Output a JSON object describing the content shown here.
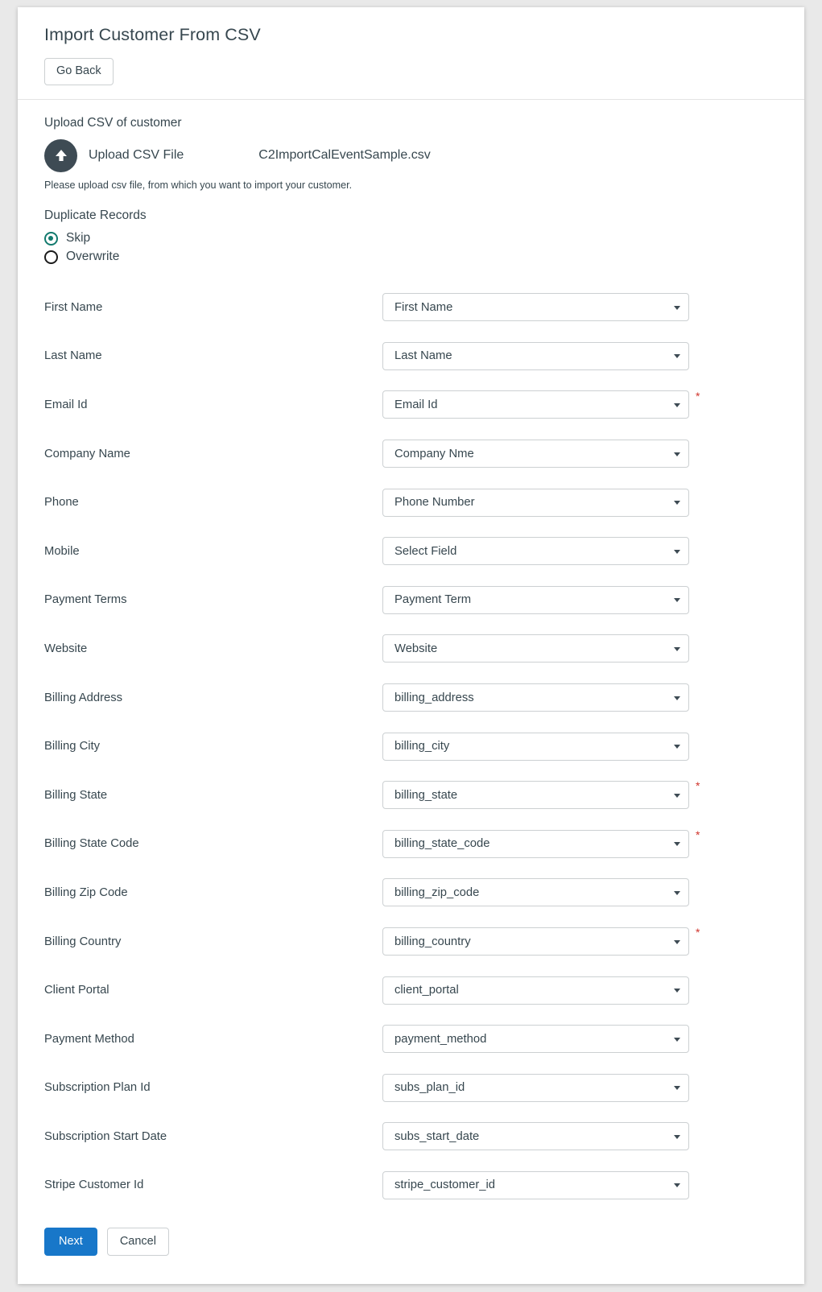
{
  "header": {
    "title": "Import Customer From CSV",
    "go_back_label": "Go Back"
  },
  "upload": {
    "section_title": "Upload CSV of customer",
    "button_label": "Upload CSV File",
    "file_name": "C2ImportCalEventSample.csv",
    "hint": "Please upload csv file, from which you want to import your customer.",
    "icon": "upload-arrow-icon"
  },
  "duplicates": {
    "section_title": "Duplicate Records",
    "options": [
      {
        "label": "Skip",
        "selected": true
      },
      {
        "label": "Overwrite",
        "selected": false
      }
    ]
  },
  "mapping": {
    "rows": [
      {
        "label": "First Name",
        "value": "First Name",
        "required": false
      },
      {
        "label": "Last Name",
        "value": "Last Name",
        "required": false
      },
      {
        "label": "Email Id",
        "value": "Email Id",
        "required": true
      },
      {
        "label": "Company Name",
        "value": "Company Nme",
        "required": false
      },
      {
        "label": "Phone",
        "value": "Phone Number",
        "required": false
      },
      {
        "label": "Mobile",
        "value": "Select Field",
        "required": false
      },
      {
        "label": "Payment Terms",
        "value": "Payment Term",
        "required": false
      },
      {
        "label": "Website",
        "value": "Website",
        "required": false
      },
      {
        "label": "Billing Address",
        "value": "billing_address",
        "required": false
      },
      {
        "label": "Billing City",
        "value": "billing_city",
        "required": false
      },
      {
        "label": "Billing State",
        "value": "billing_state",
        "required": true
      },
      {
        "label": "Billing State Code",
        "value": "billing_state_code",
        "required": true
      },
      {
        "label": "Billing Zip Code",
        "value": "billing_zip_code",
        "required": false
      },
      {
        "label": "Billing Country",
        "value": "billing_country",
        "required": true
      },
      {
        "label": "Client Portal",
        "value": "client_portal",
        "required": false
      },
      {
        "label": "Payment Method",
        "value": "payment_method",
        "required": false
      },
      {
        "label": "Subscription Plan Id",
        "value": "subs_plan_id",
        "required": false
      },
      {
        "label": "Subscription Start Date",
        "value": "subs_start_date",
        "required": false
      },
      {
        "label": "Stripe Customer Id",
        "value": "stripe_customer_id",
        "required": false
      }
    ],
    "required_marker": "*"
  },
  "footer": {
    "next_label": "Next",
    "cancel_label": "Cancel"
  },
  "colors": {
    "primary_button": "#1877c9",
    "radio_selected": "#137a6e",
    "required_star": "#d0342c",
    "text": "#37474f",
    "upload_icon_bg": "#3e4b54"
  }
}
